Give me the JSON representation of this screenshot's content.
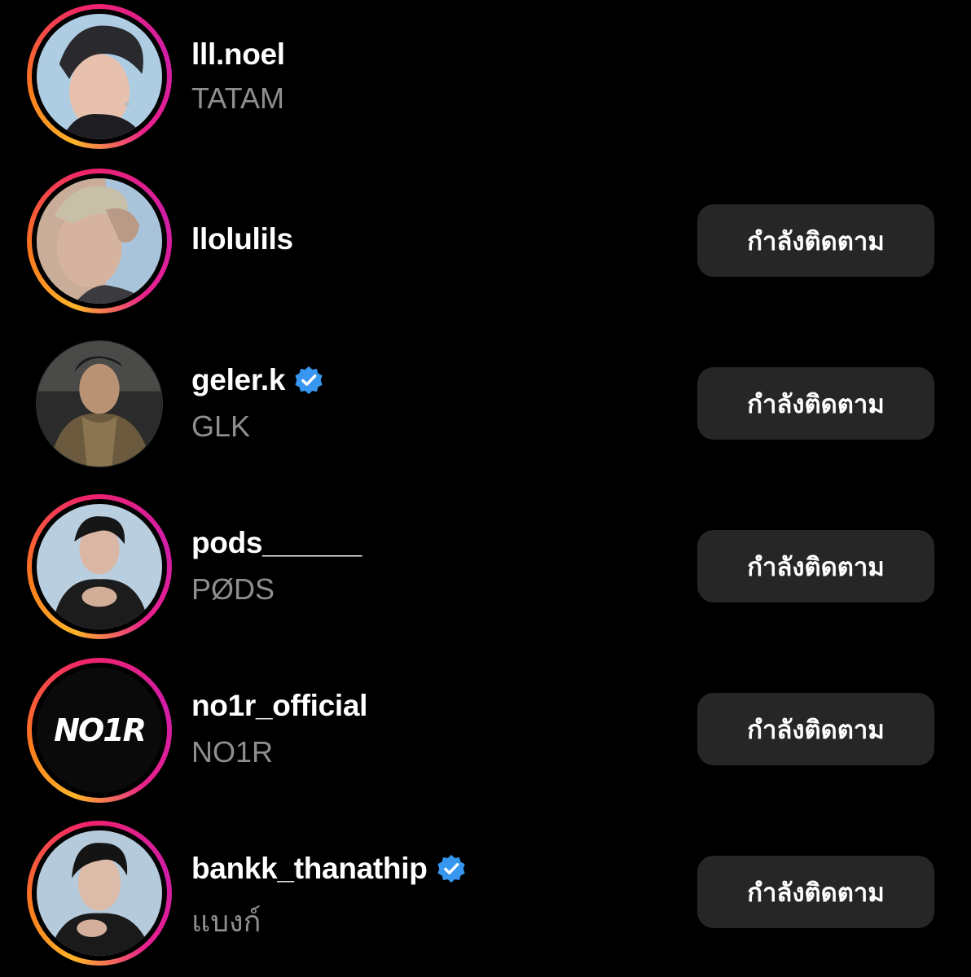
{
  "accounts": [
    {
      "username": "lll.noel",
      "name": "TATAM",
      "verified": false,
      "story_ring": true,
      "button": ""
    },
    {
      "username": "llolulils",
      "name": "",
      "verified": false,
      "story_ring": true,
      "button": "กำลังติดตาม"
    },
    {
      "username": "geler.k",
      "name": "GLK",
      "verified": true,
      "story_ring": false,
      "button": "กำลังติดตาม"
    },
    {
      "username": "pods______",
      "name": "PØDS",
      "verified": false,
      "story_ring": true,
      "button": "กำลังติดตาม"
    },
    {
      "username": "no1r_official",
      "name": "NO1R",
      "verified": false,
      "story_ring": true,
      "button": "กำลังติดตาม",
      "avatar_logo": "NO1R"
    },
    {
      "username": "bankk_thanathip",
      "name": "แบงก์",
      "verified": true,
      "story_ring": true,
      "button": "กำลังติดตาม"
    }
  ],
  "colors": {
    "background": "#000000",
    "button_bg": "#262626",
    "secondary_text": "#8e8e8e",
    "verified_badge": "#3797f0",
    "story_ring_gradient": [
      "#fdb42a",
      "#fd7a1e",
      "#f0226a",
      "#d11ea8"
    ]
  }
}
